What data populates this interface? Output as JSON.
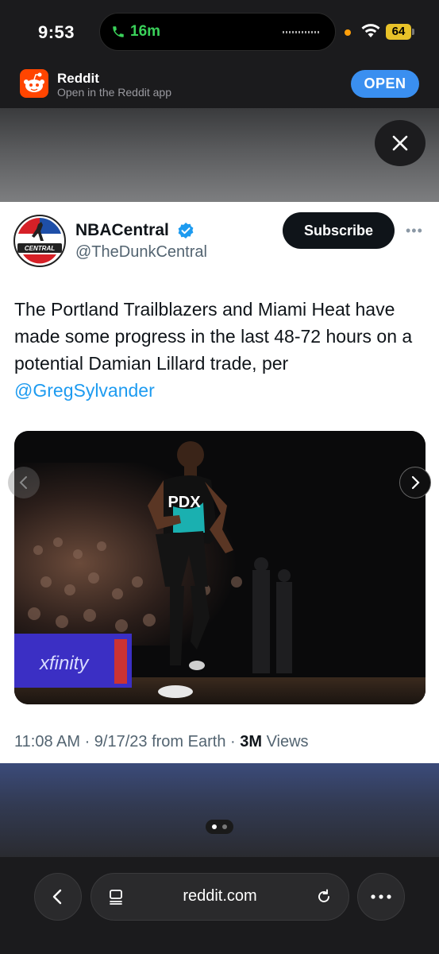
{
  "status_bar": {
    "time": "9:53",
    "call_duration": "16m",
    "battery": "64"
  },
  "banner": {
    "app_name": "Reddit",
    "subtitle": "Open in the Reddit app",
    "open_label": "OPEN"
  },
  "tweet": {
    "display_name": "NBACentral",
    "handle": "@TheDunkCentral",
    "subscribe_label": "Subscribe",
    "more_label": "•••",
    "text": "The Portland Trailblazers and Miami Heat have made some progress in the last 48-72 hours on a potential Damian Lillard trade, per ",
    "mention": "@GregSylvander",
    "avatar_text": "CENTRAL",
    "jersey_text": "PDX",
    "ad_board_text": "xfinity",
    "meta_prefix": "11:08 AM · 9/17/23 from Earth · ",
    "views_count": "3M",
    "views_label": " Views"
  },
  "browser": {
    "url": "reddit.com"
  },
  "colors": {
    "accent_blue": "#3a8ff0",
    "link_blue": "#1d9bf0",
    "reddit_orange": "#ff4500",
    "call_green": "#3ad15a"
  }
}
